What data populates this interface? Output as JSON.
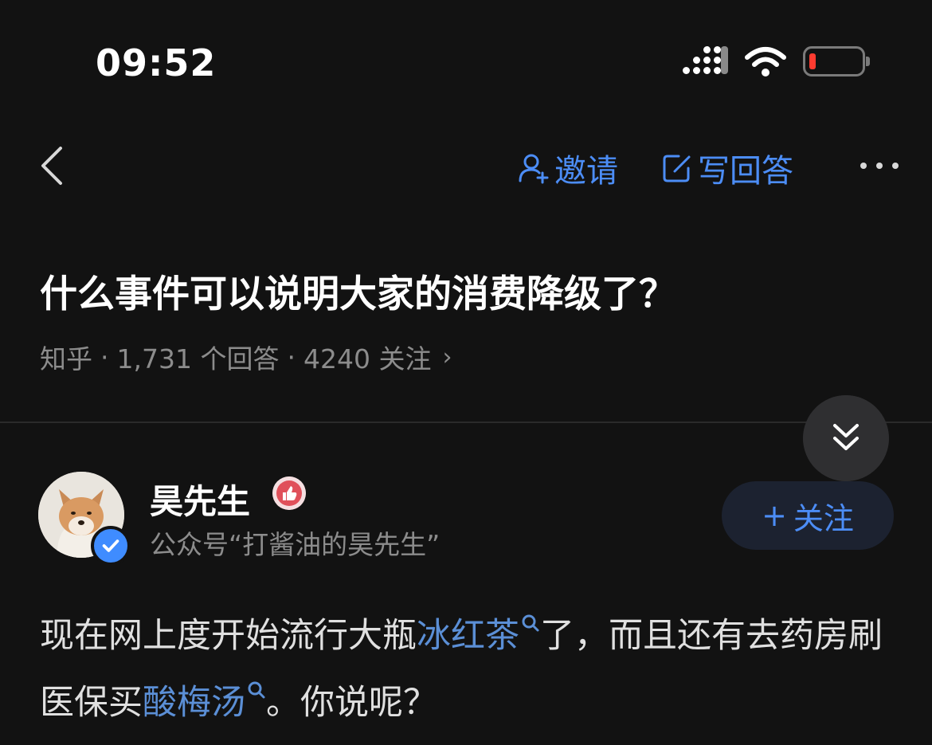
{
  "status_bar": {
    "time": "09:52",
    "battery_color": "#ff3b30"
  },
  "nav": {
    "invite_label": "邀请",
    "write_answer_label": "写回答",
    "accent_color": "#4c8df6",
    "icons": [
      "back-chevron-icon",
      "add-user-icon",
      "edit-icon",
      "more-icon"
    ]
  },
  "question": {
    "title": "什么事件可以说明大家的消费降级了？",
    "source": "知乎",
    "answers": "1,731 个回答",
    "followers": "4240 关注",
    "separator": "·",
    "chevron": "›"
  },
  "author": {
    "name": "昊先生",
    "description": "公众号“打酱油的昊先生”",
    "follow_plus": "+",
    "follow_label": "关注"
  },
  "answer": {
    "seg1": "现在网上度开始流行大瓶",
    "kw1": "冰红茶",
    "seg2": "了，而且还有去药房刷医保买",
    "kw2": "酸梅汤",
    "seg3": "。你说呢？",
    "keyword_color": "#5b8fd6"
  }
}
